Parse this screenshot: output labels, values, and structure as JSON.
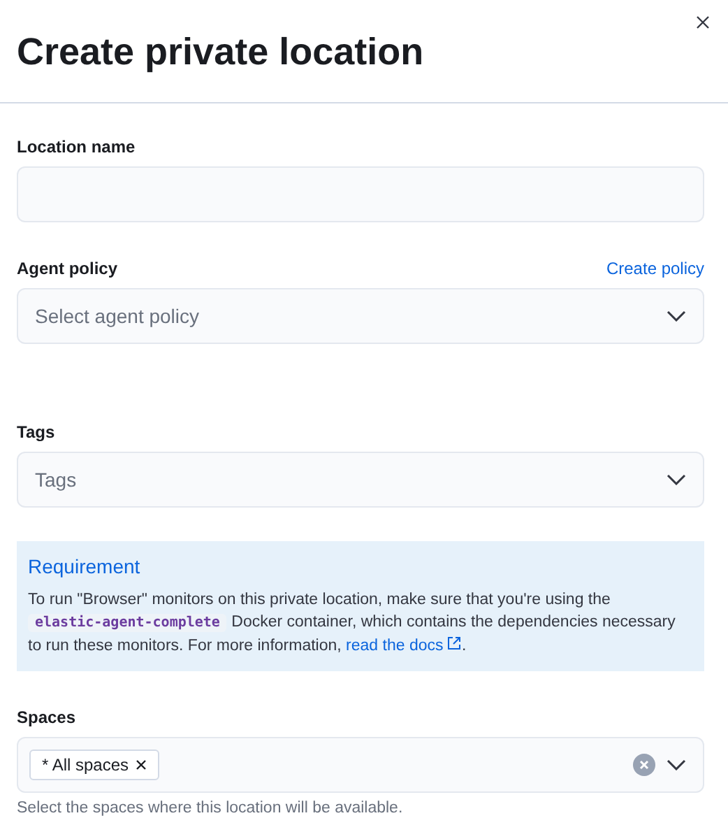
{
  "title": "Create private location",
  "location_name": {
    "label": "Location name"
  },
  "agent_policy": {
    "label": "Agent policy",
    "link": "Create policy",
    "placeholder": "Select agent policy"
  },
  "tags": {
    "label": "Tags",
    "placeholder": "Tags"
  },
  "callout": {
    "title": "Requirement",
    "text_before": "To run \"Browser\" monitors on this private location, make sure that you're using the",
    "code": "elastic-agent-complete",
    "text_middle": "Docker container, which contains the dependencies necessary to run these monitors. For more information,",
    "link": "read the docs",
    "text_after": "."
  },
  "spaces": {
    "label": "Spaces",
    "chips": [
      "* All spaces"
    ],
    "help": "Select the spaces where this location will be available."
  }
}
